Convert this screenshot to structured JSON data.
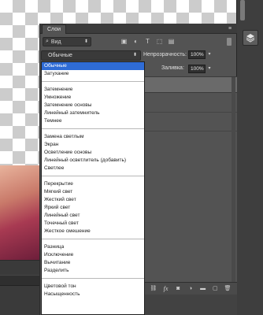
{
  "panel": {
    "tab_label": "Слои",
    "menu_icon": "panel-menu-icon",
    "filter": {
      "label": "Вид",
      "icons": [
        "image-filter-icon",
        "adjustment-filter-icon",
        "type-filter-icon",
        "shape-filter-icon",
        "smart-object-filter-icon"
      ]
    },
    "opacity_label": "Непрозрачность:",
    "opacity_value": "100%",
    "fill_label": "Заливка:",
    "fill_value": "100%",
    "footer_icons": [
      "link-icon",
      "fx-icon",
      "mask-icon",
      "adjustment-icon",
      "group-folder-icon",
      "new-layer-icon",
      "trash-icon"
    ],
    "footer_fx": "fx"
  },
  "blend_mode": {
    "current": "Обычные",
    "groups": [
      [
        "Обычные",
        "Затухание"
      ],
      [
        "Затемнение",
        "Умножение",
        "Затемнение основы",
        "Линейный затемнитель",
        "Темнее"
      ],
      [
        "Замена светлым",
        "Экран",
        "Осветление основы",
        "Линейный осветлитель (добавить)",
        "Светлее"
      ],
      [
        "Перекрытие",
        "Мягкий свет",
        "Жесткий свет",
        "Яркий свет",
        "Линейный свет",
        "Точечный свет",
        "Жесткое смешение"
      ],
      [
        "Разница",
        "Исключение",
        "Вычитание",
        "Разделить"
      ],
      [
        "Цветовой тон",
        "Насыщенность"
      ]
    ]
  },
  "dock": {
    "layers_icon": "layers-stack-icon"
  }
}
